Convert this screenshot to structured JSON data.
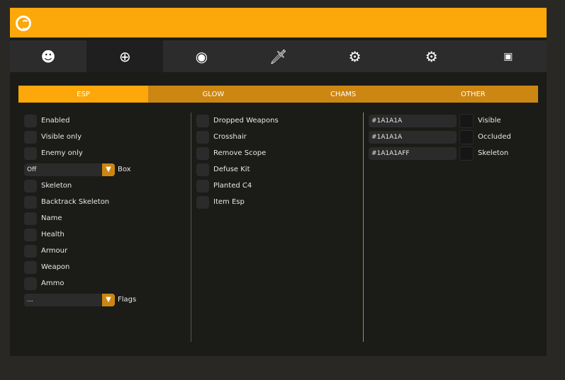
{
  "tabs_icons": [
    "user-head-icon",
    "crosshair-icon",
    "eye-radar-icon",
    "knife-icon",
    "config-file-icon",
    "gears-icon",
    "console-icon"
  ],
  "subtabs": [
    "ESP",
    "GLOW",
    "CHAMS",
    "OTHER"
  ],
  "col1": {
    "enabled": "Enabled",
    "visible_only": "Visible only",
    "enemy_only": "Enemy only",
    "box_value": "Off",
    "box_label": "Box",
    "skeleton": "Skeleton",
    "backtrack_skeleton": "Backtrack Skeleton",
    "name": "Name",
    "health": "Health",
    "armour": "Armour",
    "weapon": "Weapon",
    "ammo": "Ammo",
    "flags_value": "...",
    "flags_label": "Flags"
  },
  "col2": [
    "Dropped Weapons",
    "Crosshair",
    "Remove Scope",
    "Defuse Kit",
    "Planted C4",
    "Item Esp"
  ],
  "col3": [
    {
      "value": "#1A1A1A",
      "label": "Visible"
    },
    {
      "value": "#1A1A1A",
      "label": "Occluded"
    },
    {
      "value": "#1A1A1AFF",
      "label": "Skeleton"
    }
  ],
  "colors": {
    "accent": "#fca70a",
    "accent_dark": "#cc8612"
  }
}
